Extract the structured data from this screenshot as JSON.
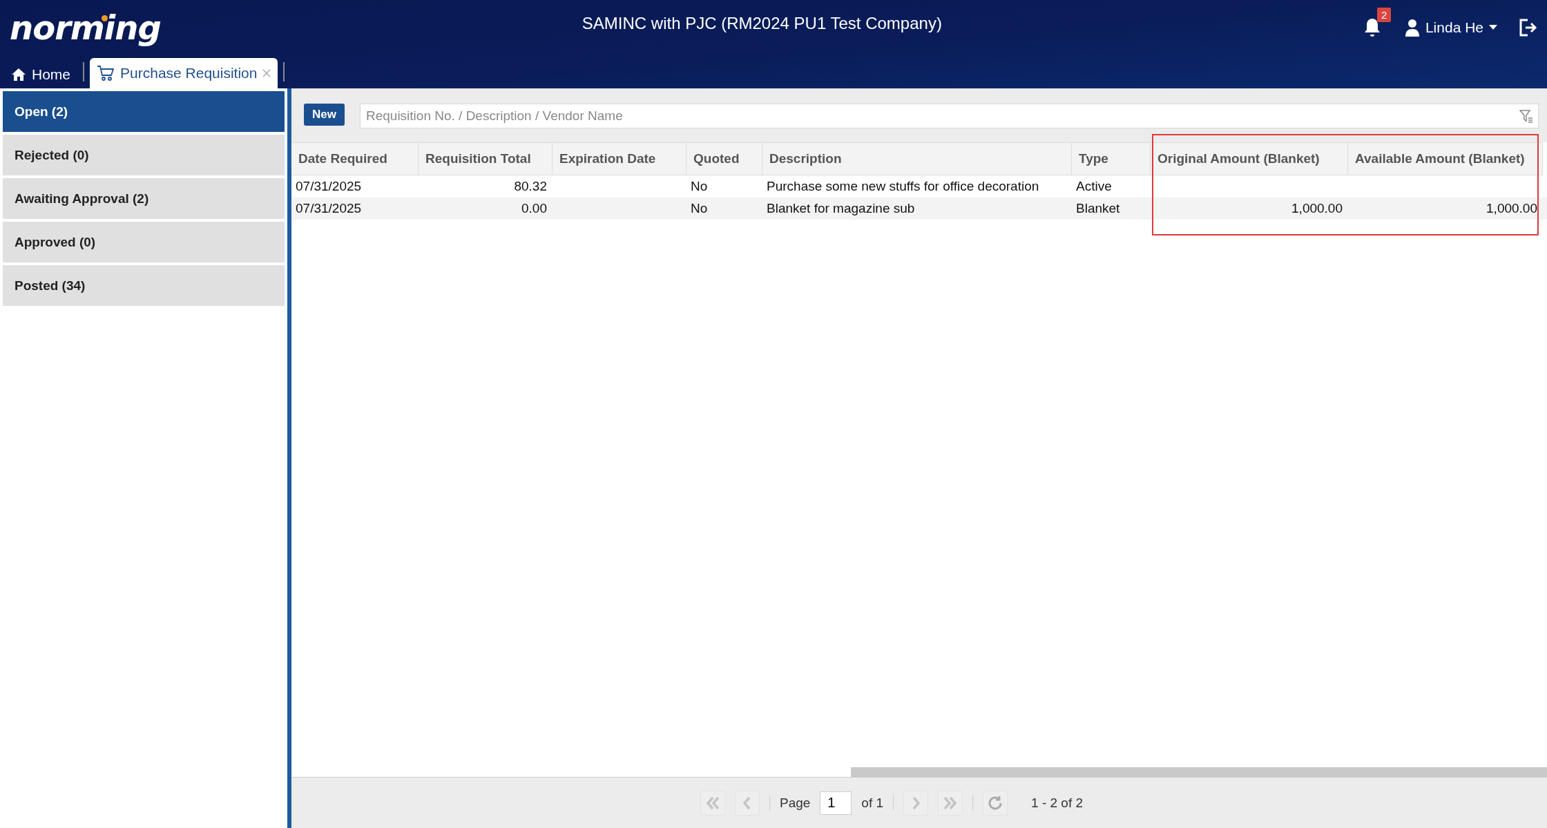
{
  "header": {
    "logo": "norming",
    "company": "SAMINC with PJC (RM2024 PU1 Test Company)",
    "notification_count": "2",
    "user": "Linda He"
  },
  "tabs": [
    {
      "label": "Home",
      "kind": "home",
      "selected": false,
      "closable": false
    },
    {
      "label": "Purchase Requisition",
      "kind": "cart",
      "selected": true,
      "closable": true
    }
  ],
  "sidebar": {
    "items": [
      {
        "label": "Open (2)",
        "selected": true
      },
      {
        "label": "Rejected (0)",
        "selected": false
      },
      {
        "label": "Awaiting Approval (2)",
        "selected": false
      },
      {
        "label": "Approved (0)",
        "selected": false
      },
      {
        "label": "Posted (34)",
        "selected": false
      }
    ]
  },
  "toolbar": {
    "new_button": "New",
    "search": {
      "placeholder": "Requisition No. / Description / Vendor Name"
    }
  },
  "table": {
    "annotation": {
      "kind": "frame"
    },
    "columns": [
      "Date Required",
      "Requisition Total",
      "Expiration Date",
      "Quoted",
      "Description",
      "Type",
      "Original Amount (Blanket)",
      "Available Amount (Blanket)"
    ],
    "rows": [
      [
        "07/31/2025",
        "80.32",
        "",
        "No",
        "Purchase some new stuffs for office decoration",
        "Active",
        "",
        ""
      ],
      [
        "07/31/2025",
        "0.00",
        "",
        "No",
        "Blanket for magazine sub",
        "Blanket",
        "1,000.00",
        "1,000.00"
      ]
    ]
  },
  "pager": {
    "page_label": "Page",
    "page": "1",
    "of": "of 1",
    "summary": "1 - 2 of 2"
  }
}
